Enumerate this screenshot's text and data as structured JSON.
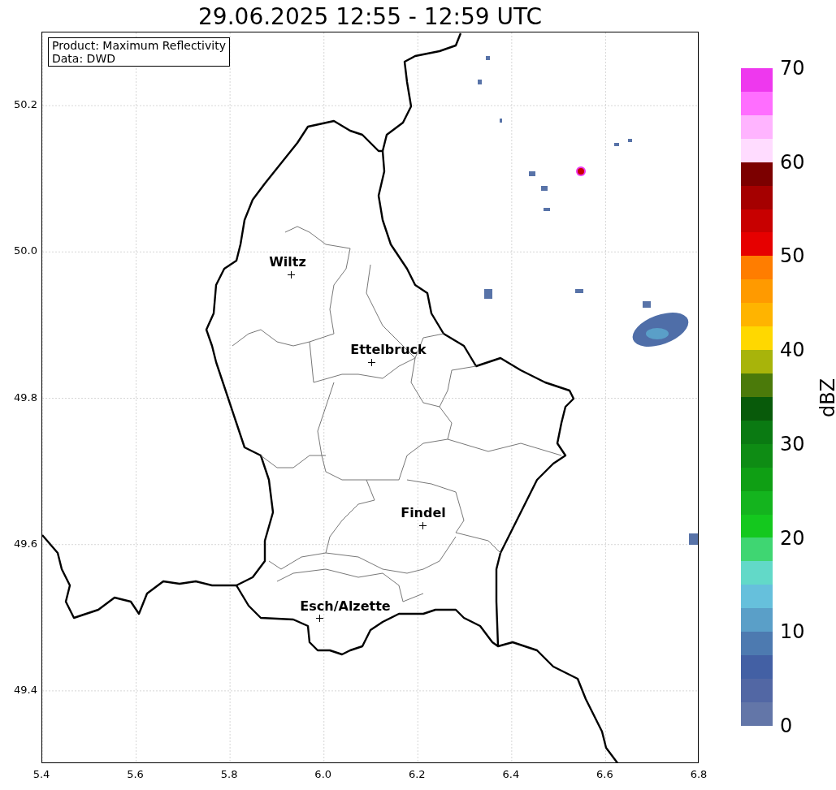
{
  "title": "29.06.2025 12:55 - 12:59 UTC",
  "info_box": [
    "Product: Maximum Reflectivity",
    "Data: DWD"
  ],
  "map": {
    "x_ticks": [
      "5.4",
      "5.6",
      "5.8",
      "6.0",
      "6.2",
      "6.4",
      "6.6",
      "6.8"
    ],
    "y_ticks": [
      "50.2",
      "50.0",
      "49.8",
      "49.6",
      "49.4"
    ],
    "cities": [
      {
        "name": "Wiltz"
      },
      {
        "name": "Ettelbruck"
      },
      {
        "name": "Findel"
      },
      {
        "name": "Esch/Alzette"
      }
    ]
  },
  "colorbar": {
    "label": "dBZ",
    "ticks": [
      "70",
      "60",
      "50",
      "40",
      "30",
      "20",
      "10",
      "0"
    ],
    "bands": [
      {
        "color": "#ee38ee"
      },
      {
        "color": "#ff6eff"
      },
      {
        "color": "#ffb4ff"
      },
      {
        "color": "#ffdcff"
      },
      {
        "color": "#7c0000"
      },
      {
        "color": "#a50000"
      },
      {
        "color": "#c80000"
      },
      {
        "color": "#e60000"
      },
      {
        "color": "#ff7d00"
      },
      {
        "color": "#ff9a00"
      },
      {
        "color": "#ffb400"
      },
      {
        "color": "#ffd800"
      },
      {
        "color": "#a8b40a"
      },
      {
        "color": "#4b7a0a"
      },
      {
        "color": "#085a0a"
      },
      {
        "color": "#0a7a12"
      },
      {
        "color": "#0e8c14"
      },
      {
        "color": "#0f9f14"
      },
      {
        "color": "#14b41e"
      },
      {
        "color": "#14c81e"
      },
      {
        "color": "#3fd672"
      },
      {
        "color": "#62d9c8"
      },
      {
        "color": "#66c0dc"
      },
      {
        "color": "#5a9fc8"
      },
      {
        "color": "#4d7ab0"
      },
      {
        "color": "#4360a4"
      },
      {
        "color": "#5267a4"
      },
      {
        "color": "#6376a8"
      }
    ]
  }
}
